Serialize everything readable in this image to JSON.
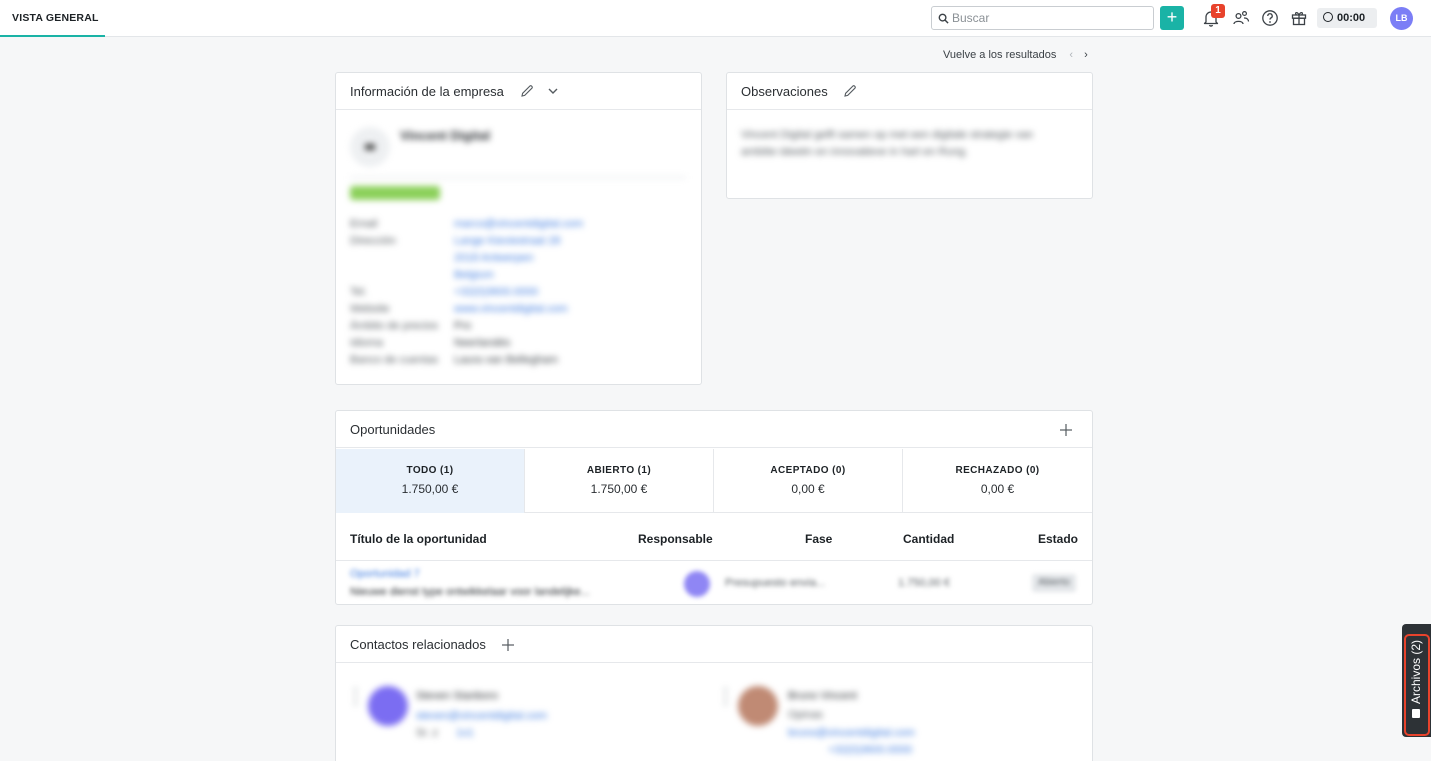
{
  "topbar": {
    "tab_label": "VISTA GENERAL",
    "search_placeholder": "Buscar",
    "add_label": "+",
    "notification_count": "1",
    "timer": "00:00",
    "user_initials": "LB"
  },
  "results_nav": {
    "label": "Vuelve a los resultados",
    "prev": "‹",
    "next": "›"
  },
  "company_card": {
    "title": "Información de la empresa",
    "name": "Vincent Digital",
    "fields": [
      {
        "key": "Email",
        "value": "marco@vincentdigital.com",
        "link": true
      },
      {
        "key": "Dirección",
        "value": "Lange Kieviestraat 28",
        "link": true
      },
      {
        "key": "",
        "value": "2018 Antwerpen",
        "link": true
      },
      {
        "key": "",
        "value": "Belgium",
        "link": true
      },
      {
        "key": "Tel.",
        "value": "+32(0)3600.0000",
        "link": true
      },
      {
        "key": "Website",
        "value": "www.vincentdigital.com",
        "link": true
      },
      {
        "key": "Ámbito de precios",
        "value": "Pro",
        "link": false
      },
      {
        "key": "Idioma",
        "value": "Neerlandés",
        "link": false
      },
      {
        "key": "Banco de cuentas",
        "value": "Laura van Bellegham",
        "link": false
      }
    ]
  },
  "observations_card": {
    "title": "Observaciones",
    "text": "Vincent Digital gelft samen op met een digitale strategie van ambitie ideeën en innovatieve in hart en Rung."
  },
  "opportunities_card": {
    "title": "Oportunidades",
    "add_label": "+",
    "tabs": [
      {
        "label": "TODO (1)",
        "amount": "1.750,00 €"
      },
      {
        "label": "ABIERTO (1)",
        "amount": "1.750,00 €"
      },
      {
        "label": "ACEPTADO (0)",
        "amount": "0,00 €"
      },
      {
        "label": "RECHAZADO (0)",
        "amount": "0,00 €"
      }
    ],
    "columns": {
      "title": "Título de la oportunidad",
      "owner": "Responsable",
      "phase": "Fase",
      "amount": "Cantidad",
      "status": "Estado"
    },
    "row": {
      "link": "Oportunidad 7",
      "description": "Nieuwe dienst type ontwikkelaar voor landelijke...",
      "phase": "Presupuesto envia...",
      "amount": "1.750,00 €",
      "status": "Abierto"
    }
  },
  "contacts_card": {
    "title": "Contactos relacionados",
    "add_label": "+",
    "contacts": [
      {
        "name": "Steven Stanboro",
        "email": "steven@vincentdigital.com",
        "role": "Sr. z",
        "tel": "1x1"
      },
      {
        "name": "Bruno Vincent",
        "role": "Opinas",
        "email": "bruno@vincentdigital.com",
        "tel": "+32(0)3600.0000"
      }
    ]
  },
  "side_panel": {
    "label": "Archivos (2)"
  },
  "colors": {
    "accent": "#1ab3a6",
    "badge": "#e8432c",
    "avatar": "#7b7ef6"
  }
}
